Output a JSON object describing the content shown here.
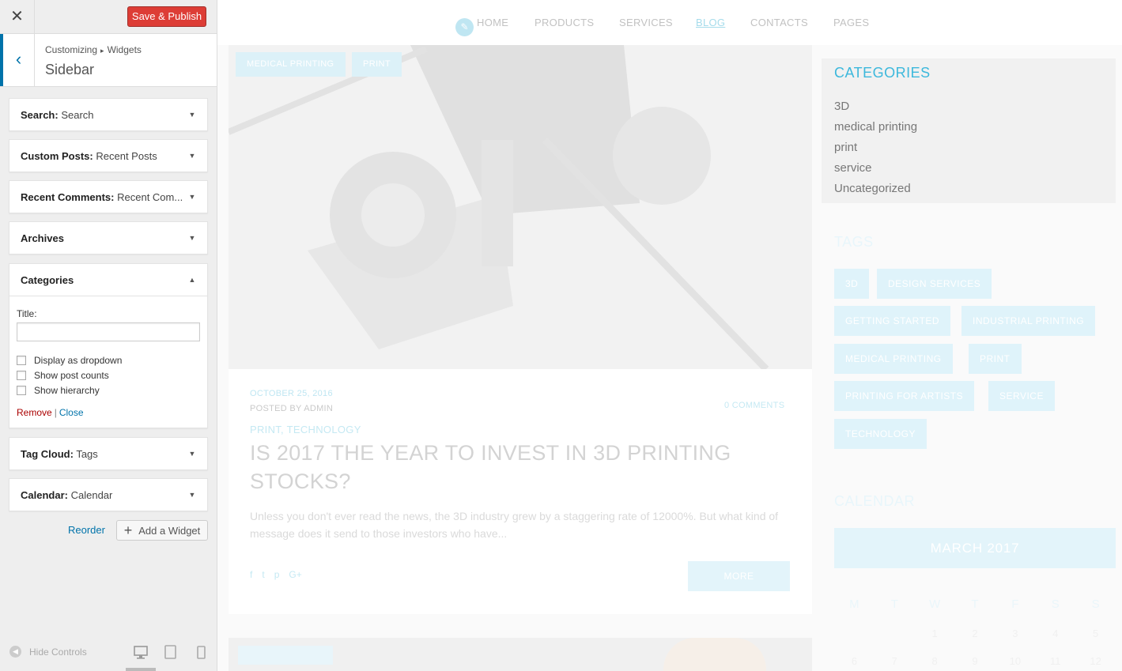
{
  "customizer": {
    "close_icon": "✕",
    "save_label": "Save & Publish",
    "back_icon": "‹",
    "breadcrumb": [
      "Customizing",
      "Widgets"
    ],
    "breadcrumb_sep": "▸",
    "section_title": "Sidebar",
    "widgets": [
      {
        "name": "Search",
        "sub": "Search",
        "state": "collapsed"
      },
      {
        "name": "Custom Posts",
        "sub": "Recent Posts",
        "state": "collapsed"
      },
      {
        "name": "Recent Comments",
        "sub": "Recent Com...",
        "state": "collapsed"
      },
      {
        "name": "Archives",
        "sub": "",
        "state": "collapsed"
      },
      {
        "name": "Categories",
        "sub": "",
        "state": "expanded"
      },
      {
        "name": "Tag Cloud",
        "sub": "Tags",
        "state": "collapsed"
      },
      {
        "name": "Calendar",
        "sub": "Calendar",
        "state": "collapsed"
      }
    ],
    "categories_form": {
      "title_label": "Title:",
      "title_value": "",
      "checkboxes": [
        {
          "label": "Display as dropdown",
          "checked": false
        },
        {
          "label": "Show post counts",
          "checked": false
        },
        {
          "label": "Show hierarchy",
          "checked": false
        }
      ],
      "remove": "Remove",
      "sep": "|",
      "close": "Close"
    },
    "reorder_label": "Reorder",
    "add_widget_label": "Add a Widget",
    "hide_controls_label": "Hide Controls"
  },
  "preview": {
    "nav": [
      "HOME",
      "PRODUCTS",
      "SERVICES",
      "BLOG",
      "CONTACTS",
      "PAGES"
    ],
    "nav_active": "BLOG",
    "post": {
      "badges": [
        "MEDICAL PRINTING",
        "PRINT"
      ],
      "date": "OCTOBER 25, 2016",
      "posted_by": "POSTED BY ADMIN",
      "comments": "0 COMMENTS",
      "categories": "PRINT, TECHNOLOGY",
      "title": "IS 2017 THE YEAR TO INVEST IN 3D PRINTING STOCKS?",
      "excerpt": "Unless you don't ever read the news, the 3D industry grew by a staggering rate of 12000%. But what kind of message does it send to those investors who have...",
      "more": "MORE"
    },
    "sidebar": {
      "categories_title": "CATEGORIES",
      "categories": [
        "3D",
        "medical printing",
        "print",
        "service",
        "Uncategorized"
      ],
      "tags_title": "TAGS",
      "tags": [
        "3D",
        "DESIGN SERVICES",
        "GETTING STARTED",
        "INDUSTRIAL PRINTING",
        "MEDICAL PRINTING",
        "PRINT",
        "PRINTING FOR ARTISTS",
        "SERVICE",
        "TECHNOLOGY"
      ],
      "calendar_title": "CALENDAR",
      "calendar_month": "MARCH 2017",
      "weekdays": [
        "M",
        "T",
        "W",
        "T",
        "F",
        "S",
        "S"
      ],
      "week1": [
        "",
        "",
        "1",
        "2",
        "3",
        "4",
        "5"
      ],
      "week2": [
        "6",
        "7",
        "8",
        "9",
        "10",
        "11",
        "12"
      ]
    }
  },
  "colors": {
    "accent": "#0073aa",
    "publish": "#dd3d36",
    "theme_blue": "#3cb8dc"
  }
}
